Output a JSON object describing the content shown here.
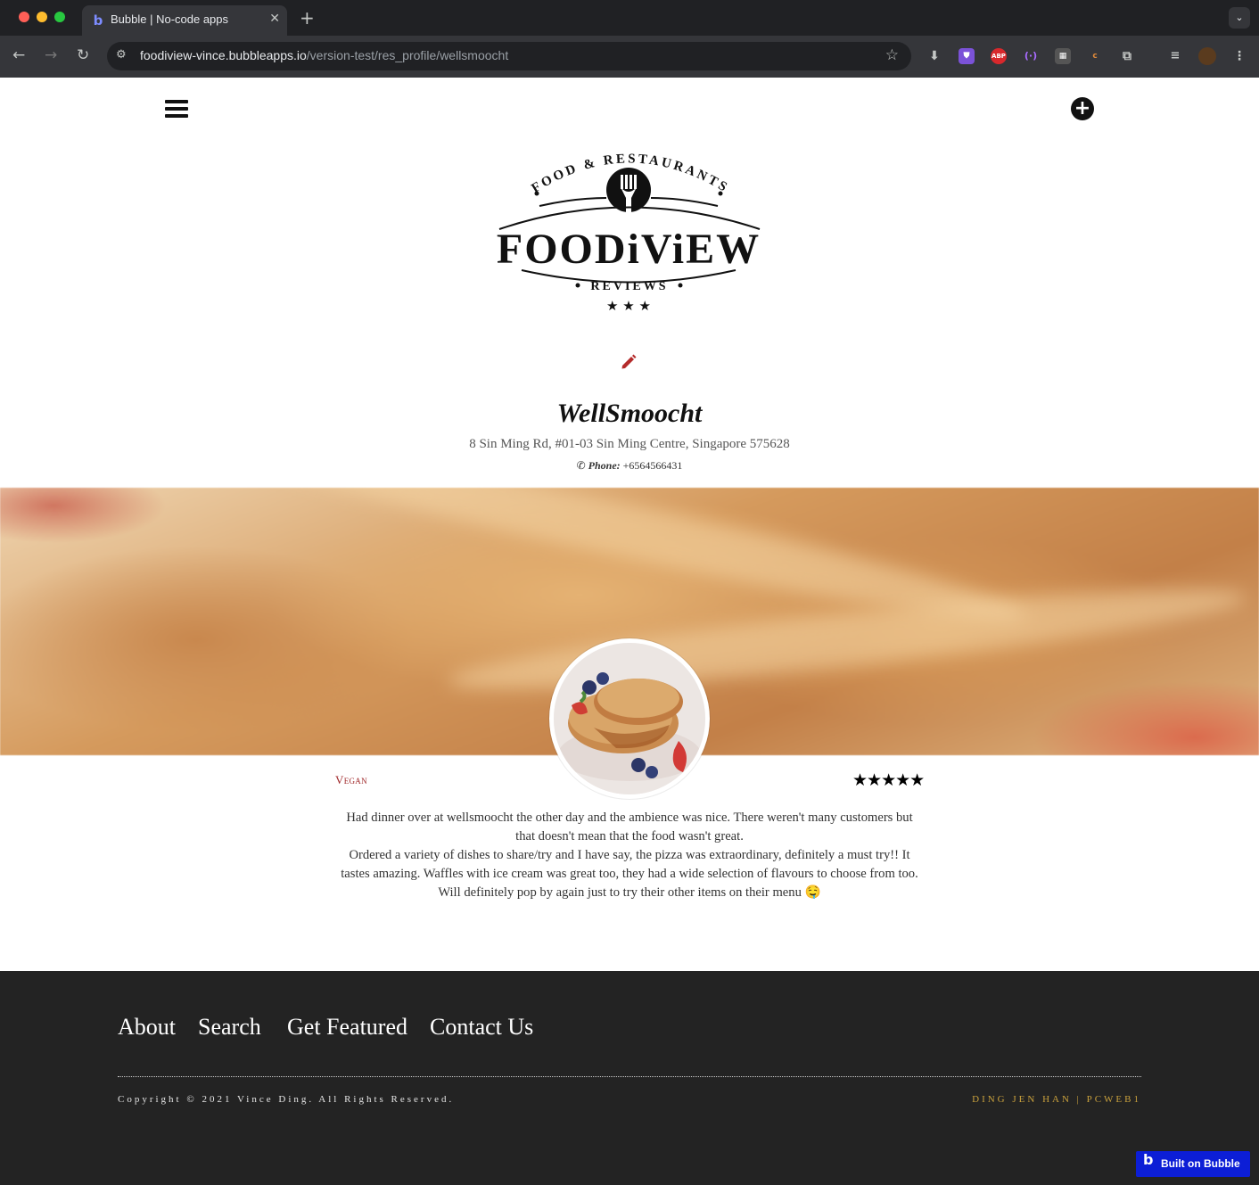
{
  "browser": {
    "tab_title": "Bubble | No-code apps",
    "url_host": "foodiview-vince.bubbleapps.io",
    "url_path": "/version-test/res_profile/wellsmoocht",
    "extensions": [
      "download-icon",
      "shield-icon",
      "ABP",
      "broadcast-icon",
      "qr-icon",
      "bubble-ext-icon",
      "puzzle-icon",
      "media-icon"
    ]
  },
  "logo": {
    "top_arc": "FOOD & RESTAURANTS",
    "wordmark": "FOODiViEW",
    "subtitle": "REVIEWS",
    "stars": "★ ★ ★"
  },
  "restaurant": {
    "name": "WellSmoocht",
    "address": "8 Sin Ming Rd, #01-03 Sin Ming Centre, Singapore 575628",
    "phone_label": "Phone:",
    "phone_icon": "✆",
    "phone": "+6564566431",
    "category": "Vegan",
    "rating_stars": "★★★★★",
    "rating": 5,
    "review_lines": [
      "Had dinner over at wellsmoocht the other day and the ambience was nice. There weren't many customers but that doesn't mean that the food wasn't great.",
      "Ordered a variety of dishes to share/try and I have say, the pizza was extraordinary, definitely a must try!! It tastes amazing. Waffles with ice cream was great too, they had a wide selection of flavours to choose from too. Will definitely pop by again just to try their other items on their menu 🤤"
    ]
  },
  "footer": {
    "nav": [
      "About",
      "Search",
      "Get Featured",
      "Contact Us"
    ],
    "copyright": "Copyright © 2021 Vince Ding. All Rights Reserved.",
    "credit": "DING JEN HAN | PCWEB1",
    "badge": "Built on Bubble"
  },
  "colors": {
    "accent_red": "#a0282a",
    "footer_bg": "#232323",
    "credit_gold": "#c9a13d",
    "badge_blue": "#0c1ed6"
  }
}
